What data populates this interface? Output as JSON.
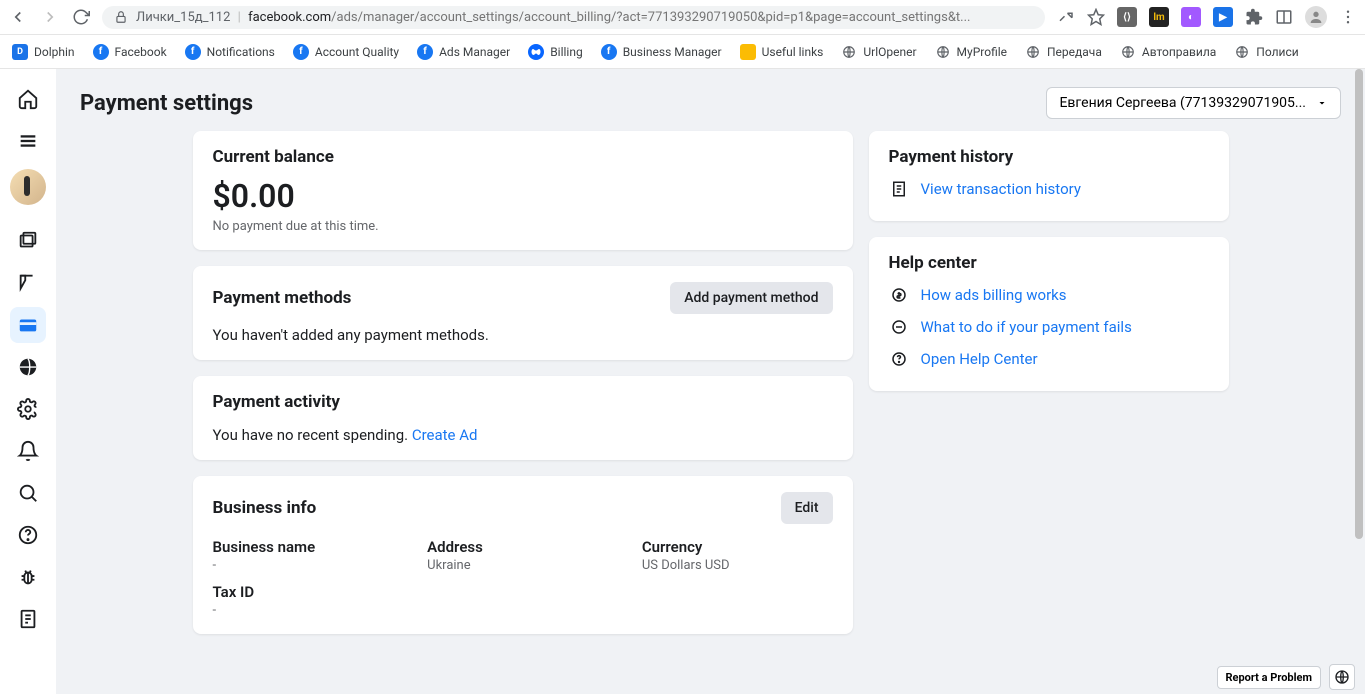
{
  "browser": {
    "tab_title": "Лички_15д_112",
    "url_domain": "facebook.com",
    "url_path": "/ads/manager/account_settings/account_billing/?act=771393290719050&pid=p1&page=account_settings&t..."
  },
  "bookmarks": [
    {
      "label": "Dolphin",
      "icon": "def"
    },
    {
      "label": "Facebook",
      "icon": "fb"
    },
    {
      "label": "Notifications",
      "icon": "fb"
    },
    {
      "label": "Account Quality",
      "icon": "fb"
    },
    {
      "label": "Ads Manager",
      "icon": "fb"
    },
    {
      "label": "Billing",
      "icon": "meta"
    },
    {
      "label": "Business Manager",
      "icon": "fb"
    },
    {
      "label": "Useful links",
      "icon": "yellow"
    },
    {
      "label": "UrlOpener",
      "icon": "globe"
    },
    {
      "label": "MyProfile",
      "icon": "globe"
    },
    {
      "label": "Передача",
      "icon": "globe"
    },
    {
      "label": "Автоправила",
      "icon": "globe"
    },
    {
      "label": "Полиси",
      "icon": "globe"
    }
  ],
  "header": {
    "title": "Payment settings",
    "account": "Евгения Сергеева (77139329071905..."
  },
  "balance_card": {
    "title": "Current balance",
    "amount": "$0.00",
    "sub": "No payment due at this time."
  },
  "methods_card": {
    "title": "Payment methods",
    "add_btn": "Add payment method",
    "body": "You haven't added any payment methods."
  },
  "activity_card": {
    "title": "Payment activity",
    "body": "You have no recent spending. ",
    "link": "Create Ad"
  },
  "biz_card": {
    "title": "Business info",
    "edit_btn": "Edit",
    "fields": {
      "name_lbl": "Business name",
      "name_val": "-",
      "addr_lbl": "Address",
      "addr_val": "Ukraine",
      "curr_lbl": "Currency",
      "curr_val": "US Dollars USD",
      "tax_lbl": "Tax ID",
      "tax_val": "-"
    }
  },
  "history_card": {
    "title": "Payment history",
    "link": "View transaction history"
  },
  "help_card": {
    "title": "Help center",
    "links": [
      "How ads billing works",
      "What to do if your payment fails",
      "Open Help Center"
    ]
  },
  "footer": {
    "report": "Report a Problem"
  }
}
